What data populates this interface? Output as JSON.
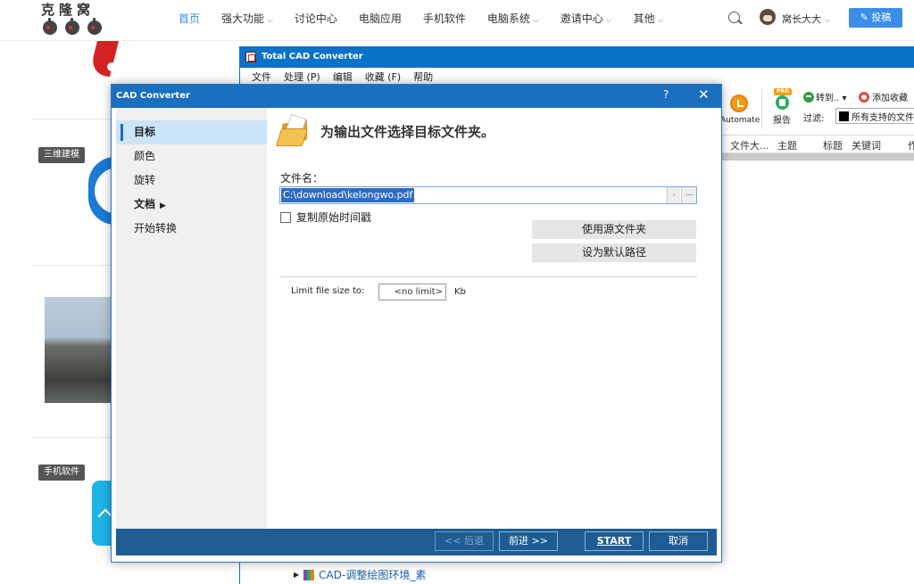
{
  "site": {
    "logo_text": "克隆窝",
    "nav": [
      {
        "label": "首页",
        "active": true,
        "caret": false
      },
      {
        "label": "强大功能",
        "active": false,
        "caret": true
      },
      {
        "label": "讨论中心",
        "active": false,
        "caret": false
      },
      {
        "label": "电脑应用",
        "active": false,
        "caret": false
      },
      {
        "label": "手机软件",
        "active": false,
        "caret": false
      },
      {
        "label": "电脑系统",
        "active": false,
        "caret": true
      },
      {
        "label": "邀请中心",
        "active": false,
        "caret": true
      },
      {
        "label": "其他",
        "active": false,
        "caret": true
      }
    ],
    "user_name": "窝长大大",
    "post_button": "✎ 投稿",
    "tags": {
      "modeling": "三维建模",
      "mobile": "手机软件"
    }
  },
  "tcc": {
    "title": "Total CAD Converter",
    "menu": [
      "文件",
      "处理 (P)",
      "编辑",
      "收藏 (F)",
      "帮助"
    ],
    "toolbar": {
      "automate": "Automate",
      "report_badge": "PRO",
      "report": "报告",
      "goto": "转到.. ▾",
      "favorite": "添加收藏",
      "filter_label": "过滤:",
      "filter_value": "所有支持的文件"
    },
    "columns": [
      "文件大...",
      "主题",
      "标题",
      "关键词",
      "作"
    ],
    "tree_item": "CAD-调整绘图环境_素"
  },
  "dialog": {
    "title": "CAD Converter",
    "help": "?",
    "close": "✕",
    "nav": [
      {
        "label": "目标",
        "active": true,
        "bold": true,
        "arrow": false
      },
      {
        "label": "颜色",
        "active": false,
        "bold": false,
        "arrow": false
      },
      {
        "label": "旋转",
        "active": false,
        "bold": false,
        "arrow": false
      },
      {
        "label": "文档",
        "active": false,
        "bold": true,
        "arrow": true
      },
      {
        "label": "开始转换",
        "active": false,
        "bold": false,
        "arrow": false
      }
    ],
    "heading": "为输出文件选择目标文件夹。",
    "filename_label": "文件名：",
    "filename_value": "C:\\download\\kelongwo.pdf",
    "filename_btn_a": ".",
    "filename_btn_b": "...",
    "copy_timestamp": "复制原始时间戳",
    "copy_timestamp_checked": false,
    "use_source_folder": "使用源文件夹",
    "set_default_path": "设为默认路径",
    "limit_label": "Limit file size to:",
    "limit_value": "<no limit>",
    "limit_unit": "Kb",
    "footer": {
      "back": "<< 后退",
      "next": "前进 >>",
      "start": "START",
      "cancel": "取消"
    }
  }
}
